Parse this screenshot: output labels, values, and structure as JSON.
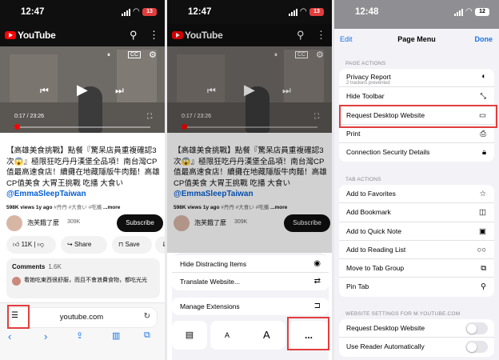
{
  "panel1": {
    "status": {
      "time": "12:47",
      "battery": "13"
    },
    "header": {
      "brand": "YouTube"
    },
    "video": {
      "timestamp": "0:17 / 23:26"
    },
    "title": "【高雄美食挑戰】點餐『驚呆店員重複確認3次😱』極限狂吃丹丹漢堡全品項！南台灣CP值最高速食店！續攤在地藏隱版牛肉麵！高雄 CP值美食 大胃王挑戰 吃播 大食い",
    "handle": "@EmmaSleepTaiwan",
    "meta": {
      "views": "598K views 1y ago",
      "tags": "#丹丹 #大食い #吃播",
      "more": "...more"
    },
    "channel": {
      "name": "泡芙餓了麼",
      "subscribers": "309K",
      "subscribe": "Subscribe"
    },
    "actions": {
      "likes": "11K",
      "share": "Share",
      "save": "Save"
    },
    "comments": {
      "label": "Comments",
      "count": "1.6K",
      "text": "看她吃東西很舒服，而且不會浪費食物，都吃光光"
    },
    "safari": {
      "url": "youtube.com"
    }
  },
  "panel2": {
    "status": {
      "time": "12:47",
      "battery": "13"
    },
    "header": {
      "brand": "YouTube"
    },
    "video": {
      "timestamp": "0:17 / 23:26"
    },
    "title": "【高雄美食挑戰】點餐『驚呆店員重複確認3次😱』極限狂吃丹丹漢堡全品項！南台灣CP值最高速食店！續攤在地藏隱版牛肉麵！高雄 CP值美食 大胃王挑戰 吃播 大食い",
    "handle": "@EmmaSleepTaiwan",
    "meta": {
      "views": "598K views 1y ago",
      "tags": "#丹丹 #大食い #吃播",
      "more": "...more"
    },
    "channel": {
      "name": "泡芙餓了麼",
      "subscribers": "309K",
      "subscribe": "Subscribe"
    },
    "sheet": {
      "items": [
        {
          "label": "Hide Distracting Items",
          "icon": "eye-slash-icon"
        },
        {
          "label": "Translate Website...",
          "icon": "translate-icon"
        },
        {
          "label": "Manage Extensions",
          "icon": "extensions-icon"
        }
      ],
      "font_small": "A",
      "font_large": "A",
      "more": "..."
    }
  },
  "panel3": {
    "status": {
      "time": "12:48",
      "battery": "12"
    },
    "menu": {
      "edit": "Edit",
      "title": "Page Menu",
      "done": "Done"
    },
    "page_actions": {
      "label": "PAGE ACTIONS",
      "items": [
        {
          "label": "Privacy Report",
          "sub": "2 trackers prevented",
          "icon": "shield-icon"
        },
        {
          "label": "Hide Toolbar",
          "icon": "resize-arrows-icon"
        },
        {
          "label": "Request Desktop Website",
          "icon": "desktop-icon"
        },
        {
          "label": "Print",
          "icon": "printer-icon"
        },
        {
          "label": "Connection Security Details",
          "icon": "lock-icon"
        }
      ]
    },
    "tab_actions": {
      "label": "TAB ACTIONS",
      "items": [
        {
          "label": "Add to Favorites",
          "icon": "star-icon"
        },
        {
          "label": "Add Bookmark",
          "icon": "book-icon"
        },
        {
          "label": "Add to Quick Note",
          "icon": "note-icon"
        },
        {
          "label": "Add to Reading List",
          "icon": "glasses-icon"
        },
        {
          "label": "Move to Tab Group",
          "icon": "tab-group-icon"
        },
        {
          "label": "Pin Tab",
          "icon": "pin-icon"
        }
      ]
    },
    "website_settings": {
      "label": "WEBSITE SETTINGS FOR M.YOUTUBE.COM",
      "items": [
        {
          "label": "Request Desktop Website",
          "on": false
        },
        {
          "label": "Use Reader Automatically",
          "on": false
        }
      ]
    }
  },
  "colors": {
    "highlight": "#e23d3d",
    "link": "#1a73e8",
    "youtube_red": "#ff0000"
  }
}
